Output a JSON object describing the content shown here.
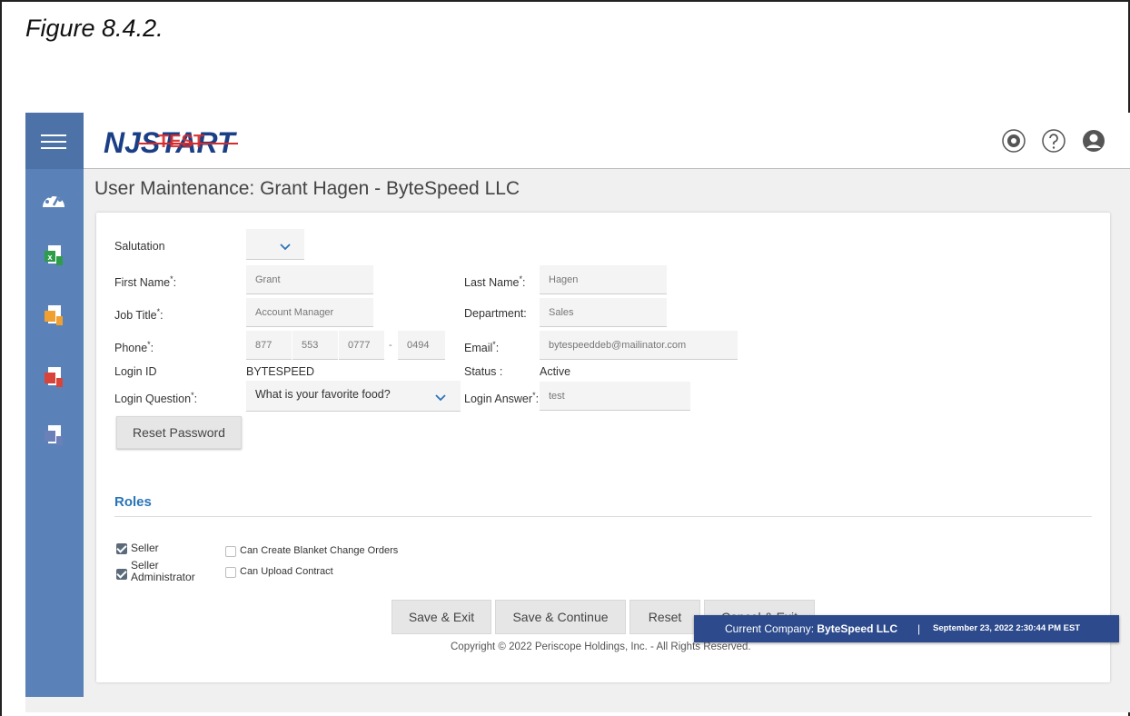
{
  "figure_caption": "Figure 8.4.2.",
  "header": {
    "logo_text": "NJSTART",
    "logo_overlay": "TEST",
    "icons": [
      "settings-icon",
      "help-icon",
      "user-profile-icon"
    ]
  },
  "sidebar": {
    "items": [
      "menu-icon",
      "dashboard-gauge-icon",
      "excel-document-icon",
      "ppt-document-icon",
      "pdf-document-icon",
      "word-document-icon"
    ]
  },
  "page_title": "User Maintenance: Grant Hagen - ByteSpeed LLC",
  "form": {
    "salutation_label": "Salutation",
    "salutation_value": "",
    "first_name_label": "First Name",
    "first_name_value": "Grant",
    "last_name_label": "Last Name",
    "last_name_value": "Hagen",
    "job_title_label": "Job Title",
    "job_title_value": "Account Manager",
    "department_label": "Department:",
    "department_value": "Sales",
    "phone_label": "Phone",
    "phone_area": "877",
    "phone_prefix": "553",
    "phone_line": "0777",
    "phone_dash": "-",
    "phone_ext": "0494",
    "email_label": "Email",
    "email_value": "bytespeeddeb@mailinator.com",
    "login_id_label": "Login ID",
    "login_id_value": "BYTESPEED",
    "status_label": "Status :",
    "status_value": "Active",
    "login_question_label": "Login Question",
    "login_question_value": "What is your favorite food?",
    "login_answer_label": "Login Answer",
    "login_answer_value": "test",
    "required_mark": "*",
    "colon": ":",
    "reset_password_label": "Reset Password"
  },
  "roles": {
    "title": "Roles",
    "items": [
      {
        "label": "Seller",
        "checked": true
      },
      {
        "label": "Seller Administrator",
        "checked": true
      },
      {
        "label": "Can Create Blanket Change Orders",
        "checked": false
      },
      {
        "label": "Can Upload Contract",
        "checked": false
      }
    ]
  },
  "actions": {
    "save_exit": "Save & Exit",
    "save_continue": "Save & Continue",
    "reset": "Reset",
    "cancel_exit": "Cancel & Exit"
  },
  "copyright": "Copyright © 2022 Periscope Holdings, Inc. - All Rights Reserved.",
  "company_banner": {
    "prefix": "Current Company: ",
    "company": "ByteSpeed LLC",
    "separator": "|",
    "timestamp": "September 23, 2022 2:30:44 PM EST"
  },
  "colors": {
    "sidebar": "#5b82b8",
    "roles_title": "#2a74b8",
    "banner": "#2c4a8c"
  }
}
